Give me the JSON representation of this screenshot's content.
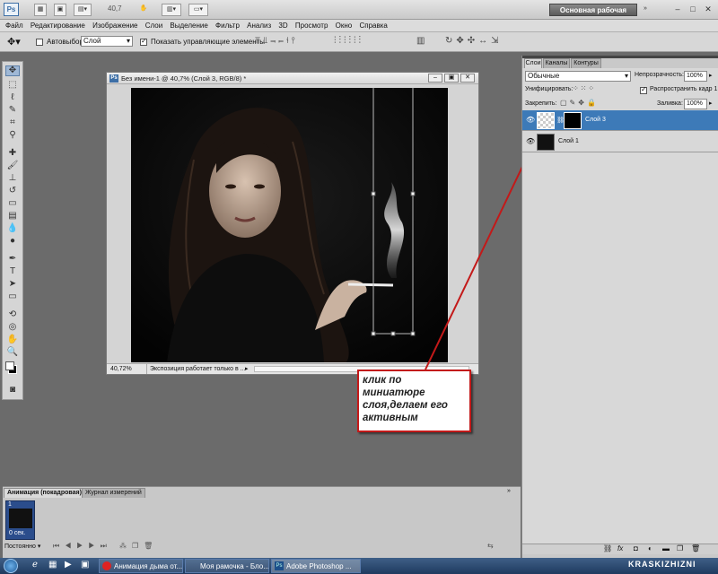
{
  "app": {
    "logo": "Ps",
    "zoom": "40,7",
    "workspace": "Основная рабочая среда",
    "window_controls": {
      "minimize": "–",
      "maximize": "□",
      "close": "✕"
    }
  },
  "menu": [
    "Файл",
    "Редактирование",
    "Изображение",
    "Слои",
    "Выделение",
    "Фильтр",
    "Анализ",
    "3D",
    "Просмотр",
    "Окно",
    "Справка"
  ],
  "options": {
    "autoselect_label": "Автовыбор:",
    "autoselect_value": "Слой",
    "show_controls_label": "Показать управляющие элементы"
  },
  "document": {
    "title": "Без имени-1 @ 40,7% (Слой 3, RGB/8) *",
    "zoom_status": "40,72%",
    "status_text": "Экспозиция работает только в ..."
  },
  "callout": {
    "text": "клик по миниатюре слоя,делаем его активным",
    "border_color": "#c31919"
  },
  "layers_panel": {
    "tabs": [
      "Слои",
      "Каналы",
      "Контуры"
    ],
    "blend_mode": "Обычные",
    "opacity_label": "Непрозрачность:",
    "opacity_value": "100%",
    "unify_label": "Унифицировать:",
    "propagate_label": "Распространить кадр 1",
    "lock_label": "Закрепить:",
    "fill_label": "Заливка:",
    "fill_value": "100%",
    "layers": [
      {
        "name": "Слой 3",
        "selected": true
      },
      {
        "name": "Слой 1",
        "selected": false
      }
    ],
    "footer_icons": [
      "link-icon",
      "fx-icon",
      "mask-icon",
      "adjustment-icon",
      "folder-icon",
      "new-layer-icon",
      "trash-icon"
    ]
  },
  "animation_panel": {
    "tabs": [
      "Анимация (покадровая)",
      "Журнал измерений"
    ],
    "frame_number": "1",
    "frame_delay": "0 сек.",
    "loop": "Постоянно"
  },
  "taskbar": {
    "items": [
      {
        "label": "Анимация дыма от...",
        "active": false
      },
      {
        "label": "Моя рамочка - Бло...",
        "active": false
      },
      {
        "label": "Adobe Photoshop ...",
        "active": true
      }
    ],
    "watermark": "KRASKIZHIZNI",
    "accent": "#1f3a5f"
  }
}
